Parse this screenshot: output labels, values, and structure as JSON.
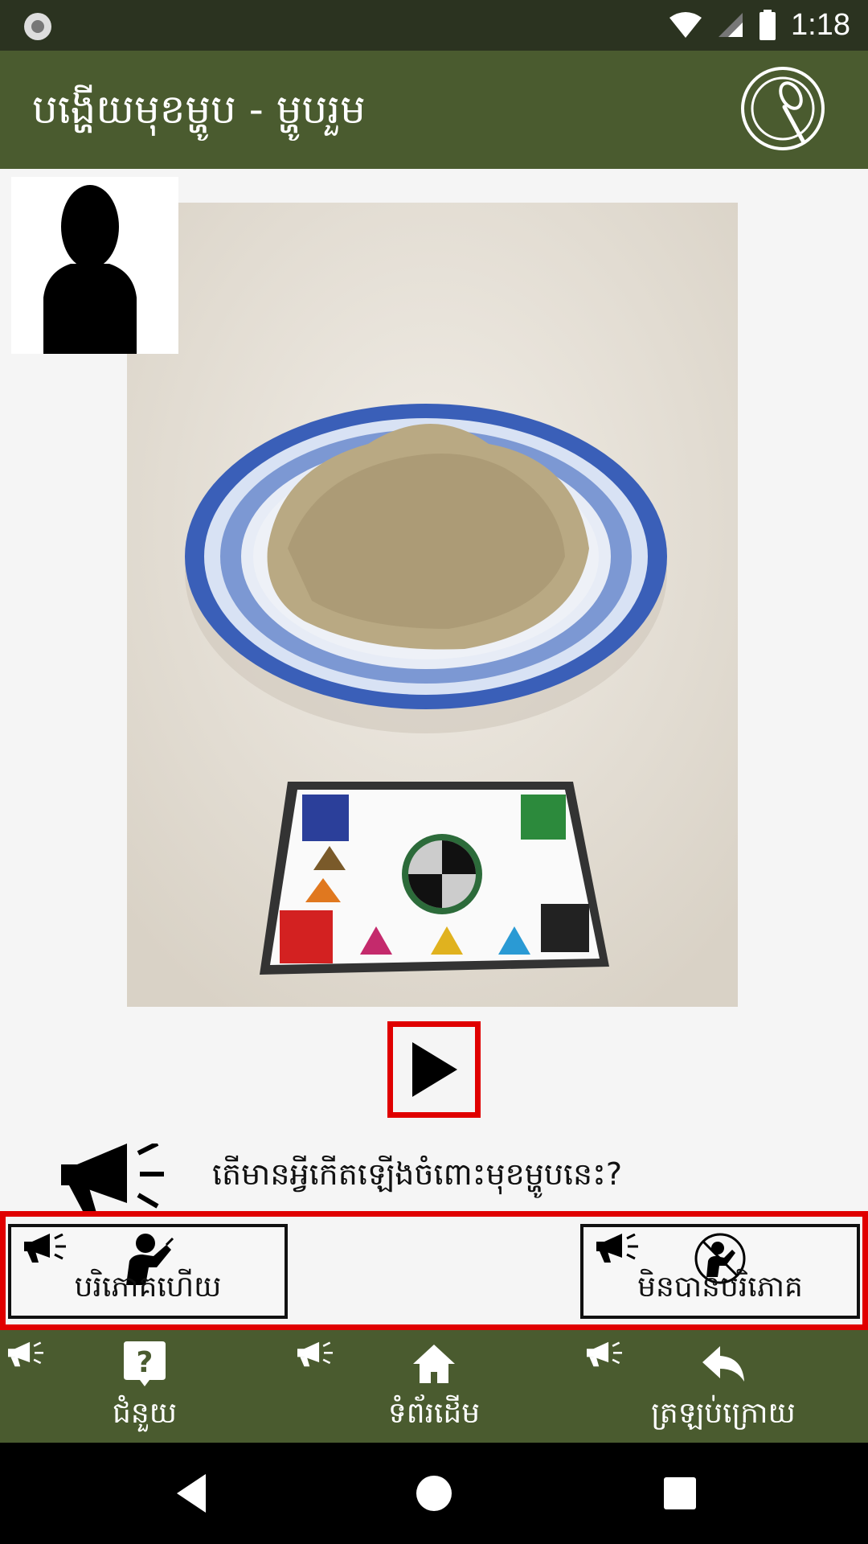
{
  "status_bar": {
    "time": "1:18"
  },
  "app_bar": {
    "title": "បង្ហើយមុខម្ហូប - ម្ហូបរួម"
  },
  "question": "តើមានអ្វីកើតឡើងចំពោះមុខម្ហូបនេះ?",
  "answers": [
    {
      "label": "បរិភោគហើយ"
    },
    {
      "label": "មិនបានបរិភោគ"
    }
  ],
  "bottom_nav": [
    {
      "label": "ជំនួយ"
    },
    {
      "label": "ទំព័រដើម"
    },
    {
      "label": "ត្រឡប់ក្រោយ"
    }
  ],
  "colors": {
    "status_bar": "#2b3320",
    "app_bar": "#4a5b2f",
    "highlight_border": "#e00000",
    "background": "#f5f5f5"
  },
  "icons": {
    "app_logo": "plate-spoon-icon",
    "play": "play-icon",
    "audio": "megaphone-icon",
    "eaten": "person-eating-icon",
    "not_eaten": "not-eating-icon",
    "help": "help-icon",
    "home": "home-icon",
    "back": "back-arrow-icon"
  }
}
